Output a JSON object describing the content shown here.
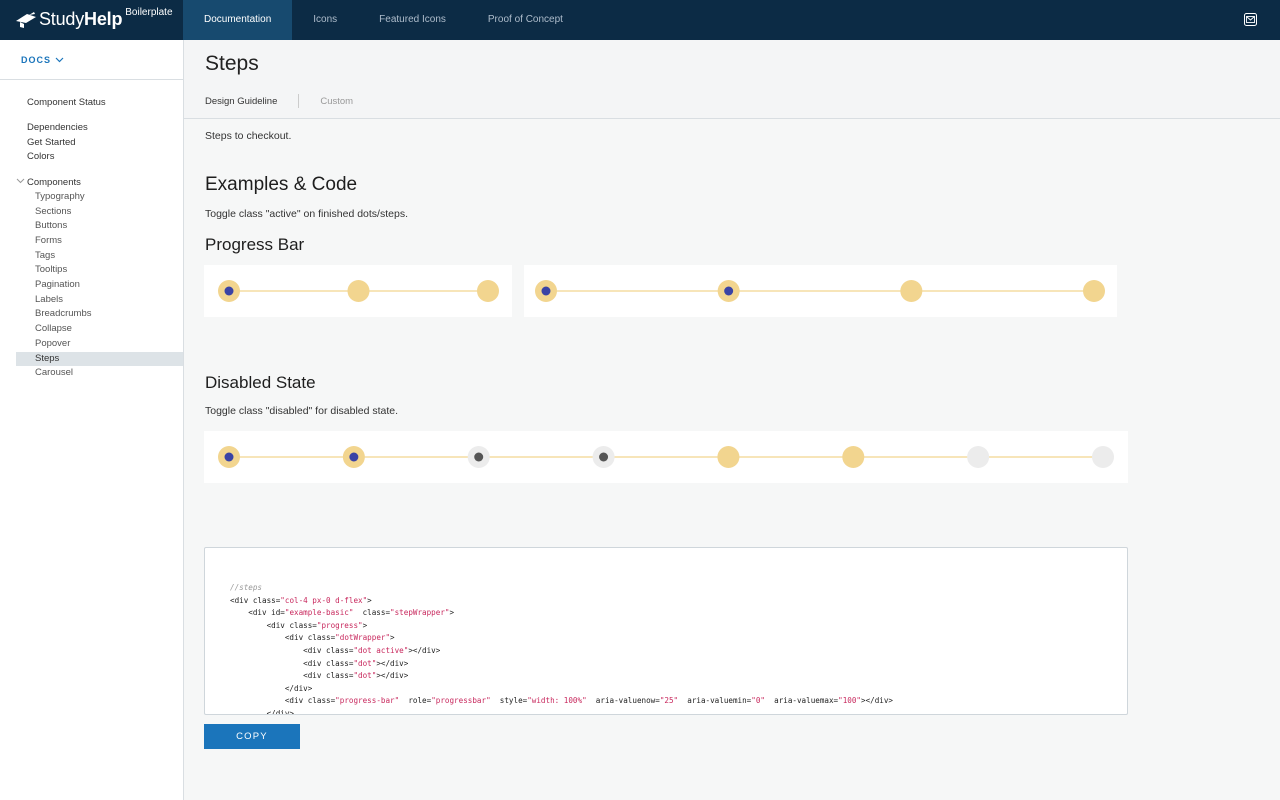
{
  "header": {
    "brand_name_light": "Study",
    "brand_name_bold": "Help",
    "brand_sub": "Boilerplate",
    "tabs": [
      {
        "label": "Documentation",
        "active": true
      },
      {
        "label": "Icons",
        "active": false
      },
      {
        "label": "Featured Icons",
        "active": false
      },
      {
        "label": "Proof of Concept",
        "active": false
      }
    ],
    "mail_icon": "mail-icon"
  },
  "sidebar": {
    "docs_label": "DOCS",
    "items": [
      {
        "label": "Component Status"
      },
      {
        "label": "Dependencies"
      },
      {
        "label": "Get Started"
      },
      {
        "label": "Colors"
      },
      {
        "label": "Components"
      }
    ],
    "components": [
      {
        "label": "Typography"
      },
      {
        "label": "Sections"
      },
      {
        "label": "Buttons"
      },
      {
        "label": "Forms"
      },
      {
        "label": "Tags"
      },
      {
        "label": "Tooltips"
      },
      {
        "label": "Pagination"
      },
      {
        "label": "Labels"
      },
      {
        "label": "Breadcrumbs"
      },
      {
        "label": "Collapse"
      },
      {
        "label": "Popover"
      },
      {
        "label": "Steps",
        "selected": true
      },
      {
        "label": "Carousel"
      }
    ]
  },
  "page": {
    "title": "Steps",
    "subtabs": [
      "Design Guideline",
      "Custom"
    ],
    "intro": "Steps to checkout.",
    "examples_heading": "Examples & Code",
    "examples_note": "Toggle class \"active\" on finished dots/steps.",
    "progress_heading": "Progress Bar",
    "disabled_heading": "Disabled State",
    "disabled_note": "Toggle class \"disabled\" for disabled state.",
    "copy_label": "COPY"
  },
  "progress_examples": [
    {
      "dots": [
        "active",
        "inactive",
        "inactive"
      ]
    },
    {
      "dots": [
        "active",
        "active",
        "inactive",
        "inactive"
      ]
    }
  ],
  "disabled_example": {
    "dots": [
      "active",
      "active",
      "disabled-active",
      "disabled-active",
      "inactive",
      "inactive",
      "disabled",
      "disabled"
    ]
  },
  "colors": {
    "topbar": "#0c2b45",
    "active_tab": "#174a6f",
    "dot_ring": "#f2d58f",
    "dot_center": "#3a43a5",
    "disabled_ring": "#ececec",
    "disabled_center": "#555555",
    "accent": "#1b75bb"
  },
  "code": {
    "lines": [
      [
        {
          "t": "//steps",
          "c": "comment"
        }
      ],
      [
        {
          "t": "<div "
        },
        {
          "t": "class="
        },
        {
          "t": "\"col-4 px-0 d-flex\"",
          "c": "attr"
        },
        {
          "t": ">"
        }
      ],
      [
        {
          "t": "    <div "
        },
        {
          "t": "id="
        },
        {
          "t": "\"example-basic\"",
          "c": "attr"
        },
        {
          "t": "  class="
        },
        {
          "t": "\"stepWrapper\"",
          "c": "attr"
        },
        {
          "t": ">"
        }
      ],
      [
        {
          "t": "        <div "
        },
        {
          "t": "class="
        },
        {
          "t": "\"progress\"",
          "c": "attr"
        },
        {
          "t": ">"
        }
      ],
      [
        {
          "t": "            <div "
        },
        {
          "t": "class="
        },
        {
          "t": "\"dotWrapper\"",
          "c": "attr"
        },
        {
          "t": ">"
        }
      ],
      [
        {
          "t": "                <div "
        },
        {
          "t": "class="
        },
        {
          "t": "\"dot active\"",
          "c": "attr"
        },
        {
          "t": "></div>"
        }
      ],
      [
        {
          "t": "                <div "
        },
        {
          "t": "class="
        },
        {
          "t": "\"dot\"",
          "c": "attr"
        },
        {
          "t": "></div>"
        }
      ],
      [
        {
          "t": "                <div "
        },
        {
          "t": "class="
        },
        {
          "t": "\"dot\"",
          "c": "attr"
        },
        {
          "t": "></div>"
        }
      ],
      [
        {
          "t": "            </div>"
        }
      ],
      [
        {
          "t": "            <div "
        },
        {
          "t": "class="
        },
        {
          "t": "\"progress-bar\"",
          "c": "attr"
        },
        {
          "t": "  role="
        },
        {
          "t": "\"progressbar\"",
          "c": "attr"
        },
        {
          "t": "  style="
        },
        {
          "t": "\"width: 100%\"",
          "c": "attr"
        },
        {
          "t": "  aria-valuenow="
        },
        {
          "t": "\"25\"",
          "c": "attr"
        },
        {
          "t": "  aria-valuemin="
        },
        {
          "t": "\"0\"",
          "c": "attr"
        },
        {
          "t": "  aria-valuemax="
        },
        {
          "t": "\"100\"",
          "c": "attr"
        },
        {
          "t": "></div>"
        }
      ],
      [
        {
          "t": "        </div>"
        }
      ]
    ]
  }
}
